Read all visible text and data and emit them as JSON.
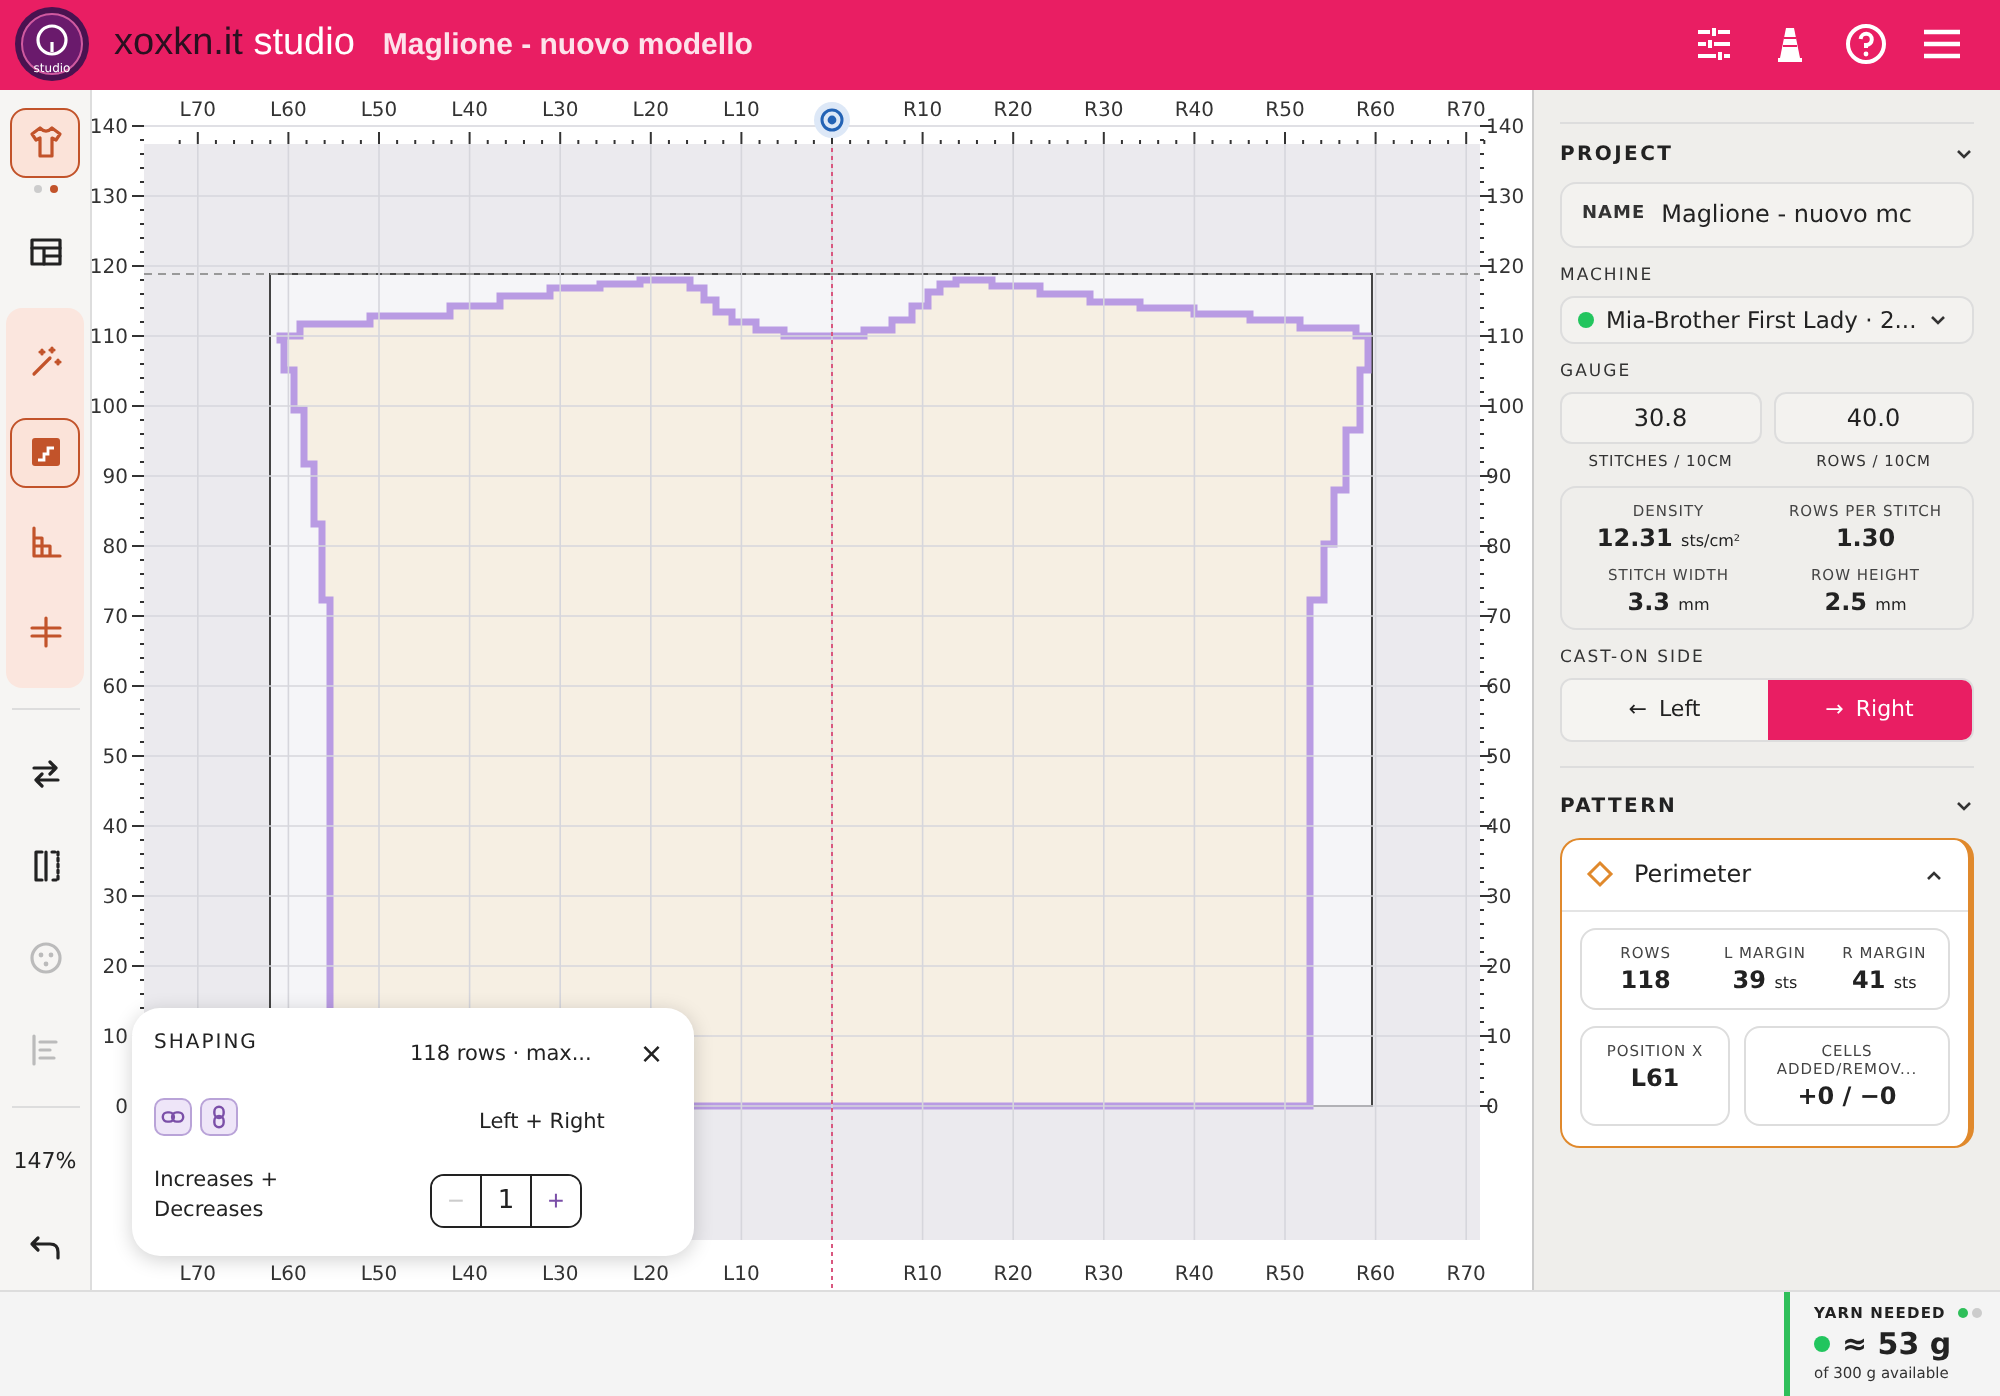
{
  "header": {
    "brand": "xoxkn.it",
    "brand_suffix": "studio",
    "logo_text": "studio",
    "project_title": "Maglione - nuovo modello"
  },
  "rail": {
    "tools": [
      {
        "selected": true,
        "disabled": false
      },
      {
        "selected": false,
        "disabled": false
      },
      {
        "selected": false,
        "disabled": false
      },
      {
        "selected": true,
        "disabled": false
      },
      {
        "selected": false,
        "disabled": false
      },
      {
        "selected": false,
        "disabled": false
      },
      {
        "selected": false,
        "disabled": false
      },
      {
        "selected": false,
        "disabled": false
      },
      {
        "selected": false,
        "disabled": true
      },
      {
        "selected": false,
        "disabled": true
      },
      {
        "selected": false,
        "disabled": false
      }
    ],
    "zoom": "147%"
  },
  "canvas": {
    "top_ruler": [
      "L70",
      "L60",
      "L50",
      "L40",
      "L30",
      "L20",
      "L10",
      "R10",
      "R20",
      "R30",
      "R40",
      "R50",
      "R60",
      "R70"
    ],
    "bottom_ruler": [
      "L70",
      "L60",
      "L50",
      "L40",
      "L30",
      "L20",
      "L10",
      "R10",
      "R20",
      "R30",
      "R40",
      "R50",
      "R60",
      "R70"
    ],
    "left_ruler": [
      "140",
      "130",
      "120",
      "110",
      "100",
      "90",
      "80",
      "70",
      "60",
      "50",
      "40",
      "30",
      "20",
      "10",
      "0"
    ],
    "right_ruler": [
      "140",
      "130",
      "120",
      "110",
      "100",
      "90",
      "80",
      "70",
      "60",
      "50",
      "40",
      "30",
      "20",
      "10",
      "0"
    ]
  },
  "shaping": {
    "title": "SHAPING",
    "summary": "118 rows · max...",
    "close": "×",
    "links": [
      {
        "selected": false
      },
      {
        "selected": false
      }
    ],
    "sides": "Left + Right",
    "mode": "Increases + Decreases",
    "decrement": {
      "label": "−",
      "disabled": true
    },
    "value": "1",
    "increment": {
      "label": "+",
      "disabled": false
    }
  },
  "panel": {
    "project": {
      "title": "PROJECT",
      "name_label": "NAME",
      "name_value": "Maglione - nuovo mc",
      "machine_label": "MACHINE",
      "machine": {
        "label": "Mia-Brother First Lady · 2...",
        "color": "#22c55e"
      },
      "gauge_label": "GAUGE",
      "gauge": [
        {
          "value": "30.8",
          "caption": "STITCHES / 10CM"
        },
        {
          "value": "40.0",
          "caption": "ROWS / 10CM"
        }
      ],
      "stats": [
        {
          "label": "DENSITY",
          "value": "12.31",
          "unit": "sts/cm²"
        },
        {
          "label": "ROWS PER STITCH",
          "value": "1.30"
        },
        {
          "label": "STITCH WIDTH",
          "value": "3.3",
          "unit": "mm"
        },
        {
          "label": "ROW HEIGHT",
          "value": "2.5",
          "unit": "mm"
        }
      ],
      "cast_on_label": "CAST-ON SIDE",
      "cast_on": [
        {
          "arrow": "←",
          "label": "Left",
          "selected": false
        },
        {
          "arrow": "→",
          "label": "Right",
          "selected": true
        }
      ]
    },
    "pattern": {
      "title": "PATTERN",
      "card": {
        "title": "Perimeter",
        "expanded": true,
        "stats": [
          {
            "label": "ROWS",
            "value": "118"
          },
          {
            "label": "L MARGIN",
            "value": "39",
            "unit": "sts"
          },
          {
            "label": "R MARGIN",
            "value": "41",
            "unit": "sts"
          }
        ],
        "stats2": [
          {
            "label": "POSITION X",
            "value": "L61"
          },
          {
            "label": "CELLS ADDED/REMOV...",
            "value": "+0 / −0"
          }
        ]
      }
    }
  },
  "yarn": {
    "label": "YARN NEEDED",
    "status": {
      "color": "#22c55e"
    },
    "amount": "≈ 53 g",
    "available": "of 300 g available",
    "pages": [
      {
        "selected": true
      },
      {
        "selected": false
      }
    ]
  }
}
